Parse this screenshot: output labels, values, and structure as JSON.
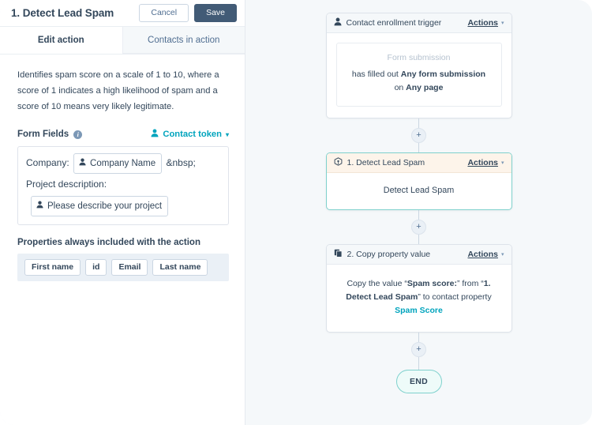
{
  "panel": {
    "title": "1. Detect Lead Spam",
    "cancel_label": "Cancel",
    "save_label": "Save",
    "tabs": [
      {
        "label": "Edit action",
        "active": true
      },
      {
        "label": "Contacts in action",
        "active": false
      }
    ],
    "description": "Identifies spam score on a scale of 1 to 10, where a score of 1 indicates a high likelihood of spam and a score of 10 means very likely legitimate.",
    "form_fields": {
      "label": "Form Fields",
      "info_glyph": "i",
      "token_link": "Contact token",
      "token_caret": "▾",
      "rows": [
        {
          "label": "Company:",
          "token": "Company Name",
          "trailing": "&nbsp;"
        },
        {
          "label": "Project description:",
          "token": "Please describe your project",
          "trailing": ""
        }
      ]
    },
    "properties": {
      "label": "Properties always included with the action",
      "chips": [
        "First name",
        "id",
        "Email",
        "Last name"
      ]
    }
  },
  "flow": {
    "plus_glyph": "+",
    "actions_label": "Actions",
    "actions_caret": "▾",
    "nodes": [
      {
        "id": "trigger",
        "icon": "contact-icon",
        "title": "Contact enrollment trigger",
        "type_label": "Form submission",
        "line1_prefix": "has filled out ",
        "line1_bold": "Any form submission",
        "line2_prefix": "on ",
        "line2_bold": "Any page"
      },
      {
        "id": "step-1",
        "icon": "cube-icon",
        "title": "1. Detect Lead Spam",
        "body": "Detect Lead Spam"
      },
      {
        "id": "step-2",
        "icon": "copy-icon",
        "title": "2. Copy property value",
        "copy": {
          "p1": "Copy the value “",
          "b1": "Spam score:",
          "p2": "” from “",
          "b2": "1. Detect Lead Spam",
          "p3": "” to contact property ",
          "t1": "Spam Score"
        }
      }
    ],
    "end_label": "END"
  },
  "colors": {
    "accent_teal": "#00a4bd",
    "save_navy": "#425b76",
    "text": "#33475b",
    "canvas_bg": "#f5f8fa",
    "highlight_border": "#7fd1cd",
    "cream_header": "#fdf4ea"
  }
}
